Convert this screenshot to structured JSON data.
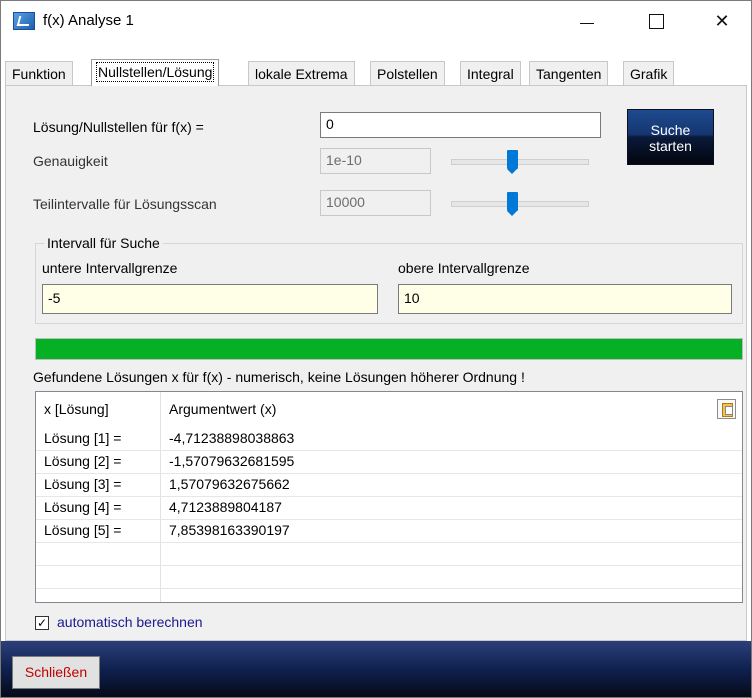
{
  "window": {
    "title": "f(x) Analyse 1",
    "controls": {
      "minimize": "—",
      "close": "✕"
    }
  },
  "tabs": [
    {
      "label": "Funktion"
    },
    {
      "label": "Nullstellen/Lösung"
    },
    {
      "label": "lokale Extrema"
    },
    {
      "label": "Polstellen"
    },
    {
      "label": "Integral"
    },
    {
      "label": "Tangenten"
    },
    {
      "label": "Grafik"
    }
  ],
  "form": {
    "solution_label": "Lösung/Nullstellen für f(x) =",
    "solution_value": "0",
    "precision_label": "Genauigkeit",
    "precision_value": "1e-10",
    "precision_slider": 0.45,
    "subintervals_label": "Teilintervalle für Lösungsscan",
    "subintervals_value": "10000",
    "subintervals_slider": 0.45,
    "search_button": "Suche\nstarten"
  },
  "interval": {
    "legend": "Intervall für Suche",
    "lower_label": "untere Intervallgrenze",
    "lower_value": "-5",
    "upper_label": "obere Intervallgrenze",
    "upper_value": "10"
  },
  "progress": {
    "percent": 100,
    "color": "#06b025"
  },
  "results": {
    "caption": "Gefundene Lösungen x für f(x) - numerisch, keine Lösungen höherer Ordnung !",
    "columns": [
      "x [Lösung]",
      "Argumentwert (x)"
    ],
    "rows": [
      {
        "name": "Lösung [1] =",
        "value": "-4,71238898038863"
      },
      {
        "name": "Lösung [2] =",
        "value": "-1,57079632681595"
      },
      {
        "name": "Lösung [3] =",
        "value": "1,57079632675662"
      },
      {
        "name": "Lösung [4] =",
        "value": "4,7123889804187"
      },
      {
        "name": "Lösung [5] =",
        "value": "7,85398163390197"
      }
    ]
  },
  "auto": {
    "label": "automatisch berechnen",
    "checked": true
  },
  "footer": {
    "close_label": "Schließen"
  },
  "icons": {
    "app": "app-icon",
    "clipboard": "clipboard-icon"
  }
}
